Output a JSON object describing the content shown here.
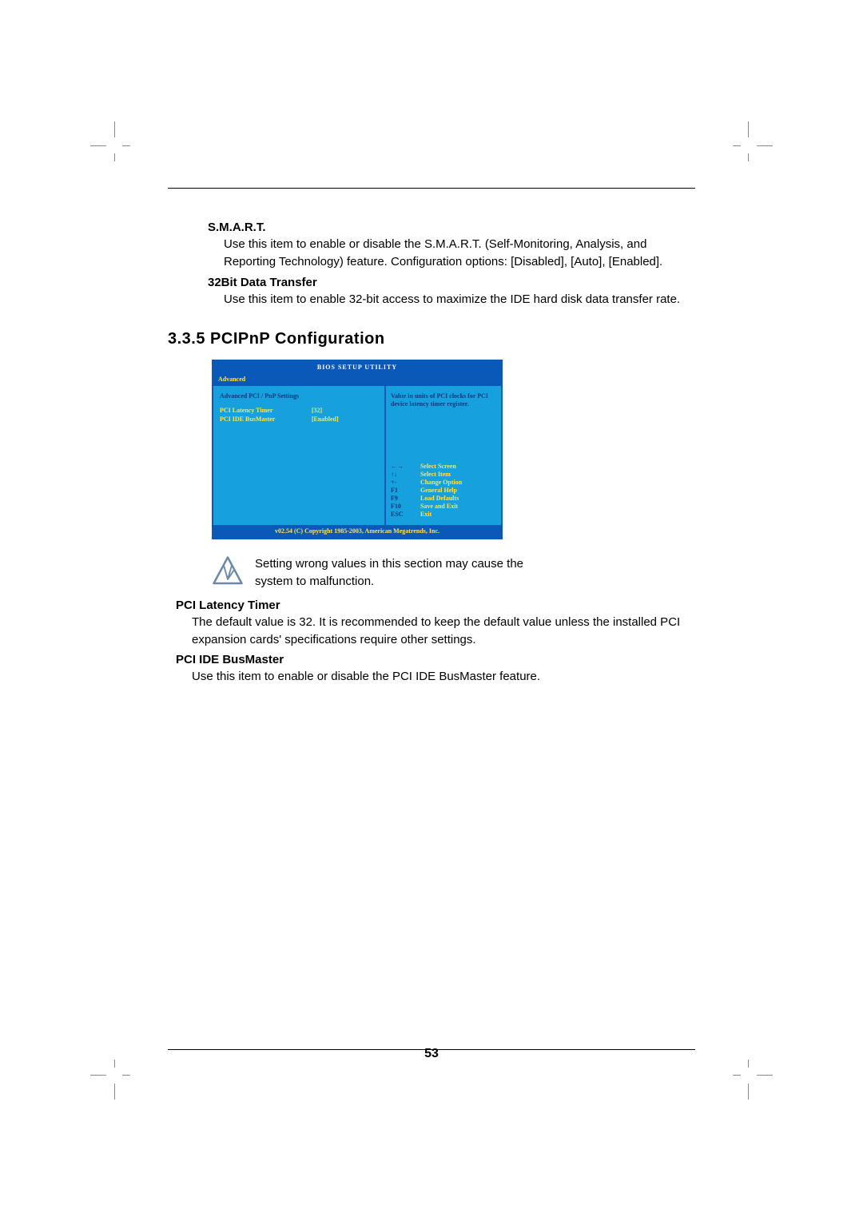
{
  "page_number": "53",
  "smart": {
    "heading": "S.M.A.R.T.",
    "text": "Use this item to enable or disable the S.M.A.R.T. (Self-Monitoring, Analysis, and Reporting Technology) feature. Configuration options: [Disabled], [Auto], [Enabled]."
  },
  "bit32": {
    "heading": "32Bit Data Transfer",
    "text": "Use this item to enable 32-bit access to maximize the IDE hard disk data transfer rate."
  },
  "section_title": "3.3.5 PCIPnP Configuration",
  "bios": {
    "title": "BIOS SETUP UTILITY",
    "tab": "Advanced",
    "panel_heading": "Advanced PCI / PnP Settings",
    "rows": [
      {
        "k": "PCI Latency Timer",
        "v": "[32]"
      },
      {
        "k": "PCI IDE BusMaster",
        "v": "[Enabled]"
      }
    ],
    "help_text": "Value in units of PCI clocks for PCI device latency timer register.",
    "keys": [
      {
        "kk": "←→",
        "kl": "Select Screen"
      },
      {
        "kk": "↑↓",
        "kl": "Select Item"
      },
      {
        "kk": "+-",
        "kl": "Change Option"
      },
      {
        "kk": "F1",
        "kl": "General Help"
      },
      {
        "kk": "F9",
        "kl": "Load Defaults"
      },
      {
        "kk": "F10",
        "kl": "Save and Exit"
      },
      {
        "kk": "ESC",
        "kl": "Exit"
      }
    ],
    "footer": "v02.54 (C) Copyright 1985-2003, American Megatrends, Inc."
  },
  "warning": "Setting wrong values in this section may cause the system to malfunction.",
  "pci_latency": {
    "heading": "PCI Latency Timer",
    "text": "The default value is 32. It is recommended to keep the default value unless the installed PCI expansion cards' specifications require other settings."
  },
  "pci_ide": {
    "heading": "PCI IDE BusMaster",
    "text": "Use this item to enable or disable the PCI IDE BusMaster feature."
  }
}
